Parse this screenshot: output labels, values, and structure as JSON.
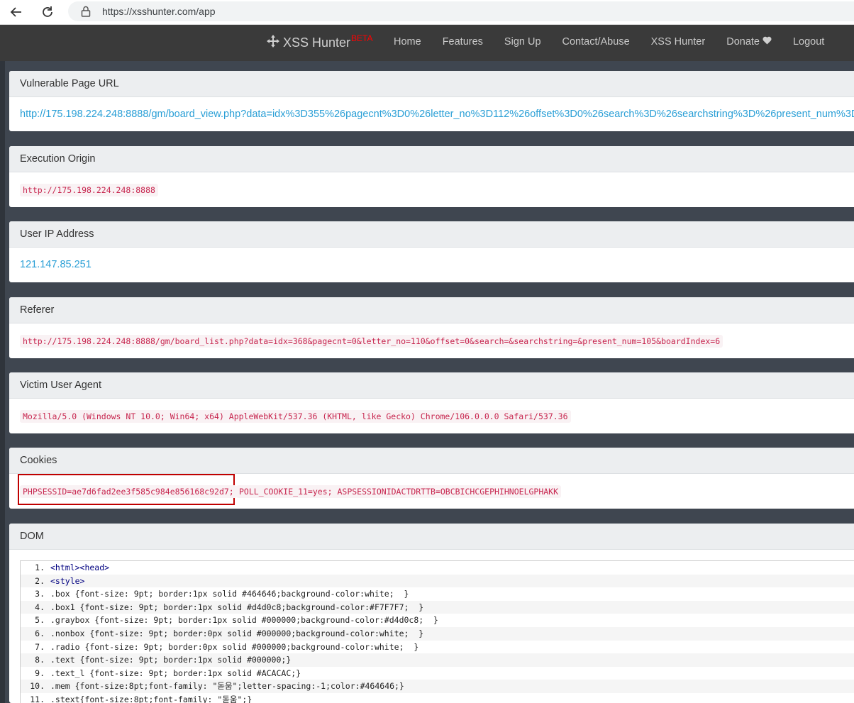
{
  "browser": {
    "url": "https://xsshunter.com/app"
  },
  "navbar": {
    "brand": "XSS Hunter",
    "beta": "BETA",
    "links": [
      "Home",
      "Features",
      "Sign Up",
      "Contact/Abuse",
      "XSS Hunter",
      "Donate",
      "Logout"
    ]
  },
  "panels": {
    "vulnerable_url": {
      "title": "Vulnerable Page URL",
      "value": "http://175.198.224.248:8888/gm/board_view.php?data=idx%3D355%26pagecnt%3D0%26letter_no%3D112%26offset%3D0%26search%3D%26searchstring%3D%26present_num%3D"
    },
    "execution_origin": {
      "title": "Execution Origin",
      "value": "http://175.198.224.248:8888"
    },
    "user_ip": {
      "title": "User IP Address",
      "value": "121.147.85.251"
    },
    "referer": {
      "title": "Referer",
      "value": "http://175.198.224.248:8888/gm/board_list.php?data=idx=368&pagecnt=0&letter_no=110&offset=0&search=&searchstring=&present_num=105&boardIndex=6"
    },
    "user_agent": {
      "title": "Victim User Agent",
      "value": "Mozilla/5.0 (Windows NT 10.0; Win64; x64) AppleWebKit/537.36 (KHTML, like Gecko) Chrome/106.0.0.0 Safari/537.36"
    },
    "cookies": {
      "title": "Cookies",
      "highlighted": "PHPSESSID=ae7d6fad2ee3f585c984e856168c92d7;",
      "rest": "POLL_COOKIE_11=yes; ASPSESSIONIDACTDRTTB=OBCBICHCGEPHIHNOELGPHAKK"
    },
    "dom": {
      "title": "DOM",
      "lines": [
        {
          "n": "1.",
          "code": "<html><head>"
        },
        {
          "n": "2.",
          "code": "<style>"
        },
        {
          "n": "3.",
          "code": ".box {font-size: 9pt; border:1px solid #464646;background-color:white;  }"
        },
        {
          "n": "4.",
          "code": ".box1 {font-size: 9pt; border:1px solid #d4d0c8;background-color:#F7F7F7;  }"
        },
        {
          "n": "5.",
          "code": ".graybox {font-size: 9pt; border:1px solid #000000;background-color:#d4d0c8;  }"
        },
        {
          "n": "6.",
          "code": ".nonbox {font-size: 9pt; border:0px solid #000000;background-color:white;  }"
        },
        {
          "n": "7.",
          "code": ".radio {font-size: 9pt; border:0px solid #000000;background-color:white;  }"
        },
        {
          "n": "8.",
          "code": ".text {font-size: 9pt; border:1px solid #000000;}"
        },
        {
          "n": "9.",
          "code": ".text_l {font-size: 9pt; border:1px solid #ACACAC;}"
        },
        {
          "n": "10.",
          "code": ".mem {font-size:8pt;font-family: \"돋움\";letter-spacing:-1;color:#464646;}"
        },
        {
          "n": "11.",
          "code": ".stext{font-size:8pt;font-family: \"돋움\";}"
        }
      ]
    }
  },
  "colors": {
    "navbar_bg": "#3a3a3a",
    "content_bg": "#3f4650",
    "link": "#2a9fd6",
    "code_red": "#c7254e",
    "beta_red": "#ff0000",
    "highlight_border": "#c00000"
  }
}
